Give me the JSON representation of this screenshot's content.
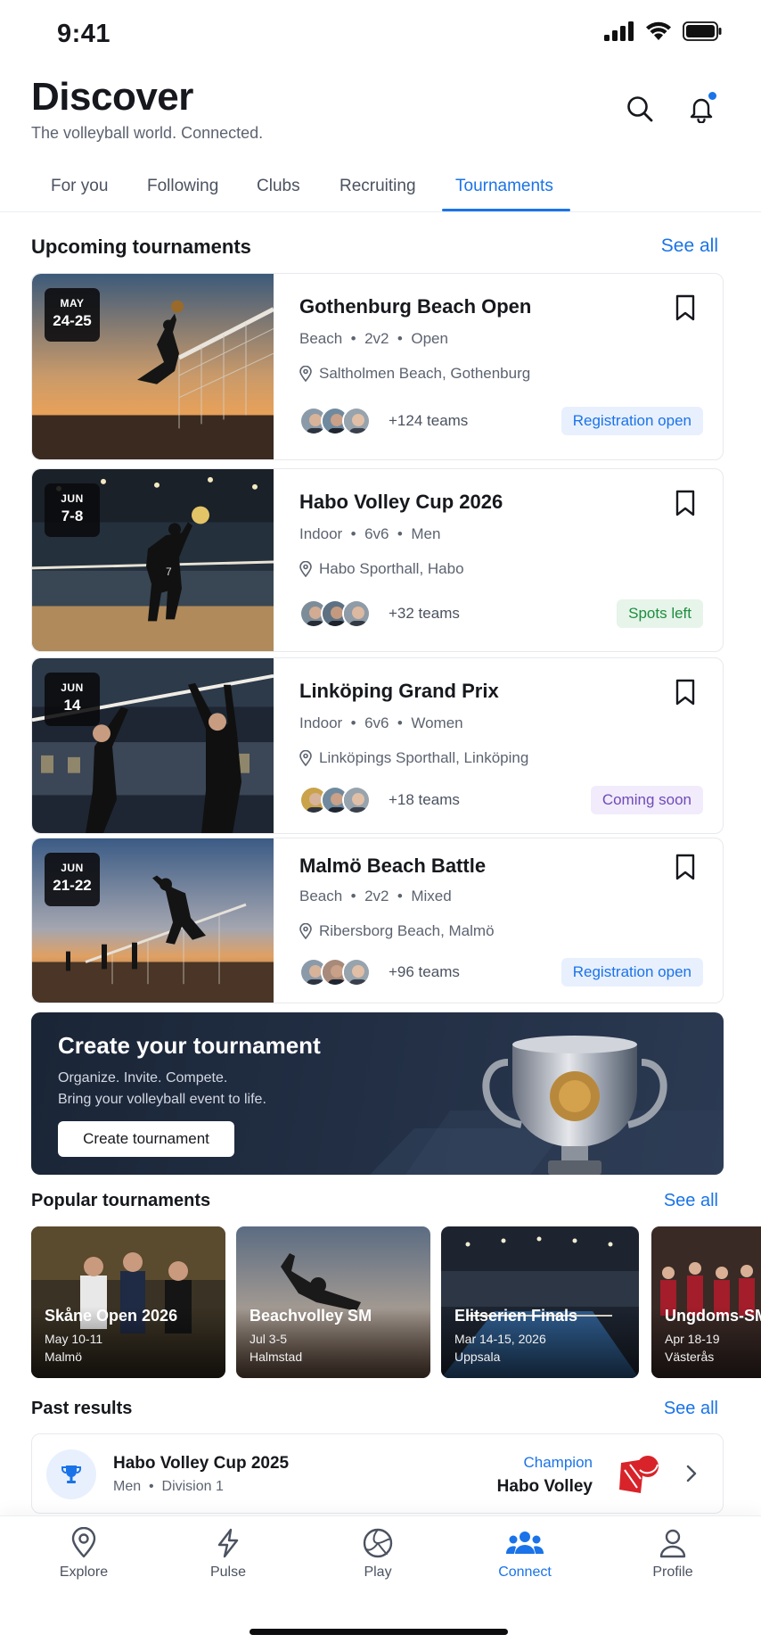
{
  "status_bar": {
    "time": "9:41"
  },
  "header": {
    "title": "Discover",
    "subtitle": "The volleyball world. Connected."
  },
  "tabs": [
    {
      "label": "For you"
    },
    {
      "label": "Following"
    },
    {
      "label": "Clubs"
    },
    {
      "label": "Recruiting"
    },
    {
      "label": "Tournaments",
      "active": true
    }
  ],
  "upcoming": {
    "title": "Upcoming tournaments",
    "see_all": "See all",
    "items": [
      {
        "month": "MAY",
        "days": "24-25",
        "name": "Gothenburg Beach Open",
        "type": "Beach",
        "format": "2v2",
        "category": "Open",
        "location": "Saltholmen Beach, Gothenburg",
        "teams": "+124 teams",
        "status": "Registration open"
      },
      {
        "month": "JUN",
        "days": "7-8",
        "name": "Habo Volley Cup 2026",
        "type": "Indoor",
        "format": "6v6",
        "category": "Men",
        "location": "Habo Sporthall, Habo",
        "teams": "+32 teams",
        "status": "Spots left"
      },
      {
        "month": "JUN",
        "days": "14",
        "name": "Linköping Grand Prix",
        "type": "Indoor",
        "format": "6v6",
        "category": "Women",
        "location": "Linköpings Sporthall, Linköping",
        "teams": "+18 teams",
        "status": "Coming soon"
      },
      {
        "month": "JUN",
        "days": "21-22",
        "name": "Malmö Beach Battle",
        "type": "Beach",
        "format": "2v2",
        "category": "Mixed",
        "location": "Ribersborg Beach, Malmö",
        "teams": "+96 teams",
        "status": "Registration open"
      }
    ]
  },
  "banner": {
    "title": "Create your tournament",
    "line1": "Organize. Invite. Compete.",
    "line2": "Bring your volleyball event to life.",
    "button": "Create tournament"
  },
  "popular": {
    "title": "Popular tournaments",
    "see_all": "See all",
    "items": [
      {
        "name": "Skåne Open 2026",
        "date": "May 10-11",
        "city": "Malmö"
      },
      {
        "name": "Beachvolley SM",
        "date": "Jul 3-5",
        "city": "Halmstad"
      },
      {
        "name": "Elitserien Finals",
        "date": "Mar 14-15, 2026",
        "city": "Uppsala"
      },
      {
        "name": "Ungdoms-SM",
        "date": "Apr 18-19",
        "city": "Västerås"
      }
    ]
  },
  "past": {
    "title": "Past results",
    "see_all": "See all",
    "items": [
      {
        "name": "Habo Volley Cup 2025",
        "sub1": "Men",
        "sub2": "Division 1",
        "label": "Champion",
        "winner": "Habo Volley"
      }
    ]
  },
  "bottom_nav": [
    {
      "label": "Explore",
      "icon": "map-pin-icon"
    },
    {
      "label": "Pulse",
      "icon": "lightning-icon"
    },
    {
      "label": "Play",
      "icon": "volleyball-icon"
    },
    {
      "label": "Connect",
      "icon": "people-icon",
      "active": true
    },
    {
      "label": "Profile",
      "icon": "person-icon"
    }
  ],
  "colors": {
    "accent": "#1a73e8",
    "green": "#1e8e3e",
    "purple": "#6f4bb8",
    "banner_bg": "#1f2b3e"
  }
}
